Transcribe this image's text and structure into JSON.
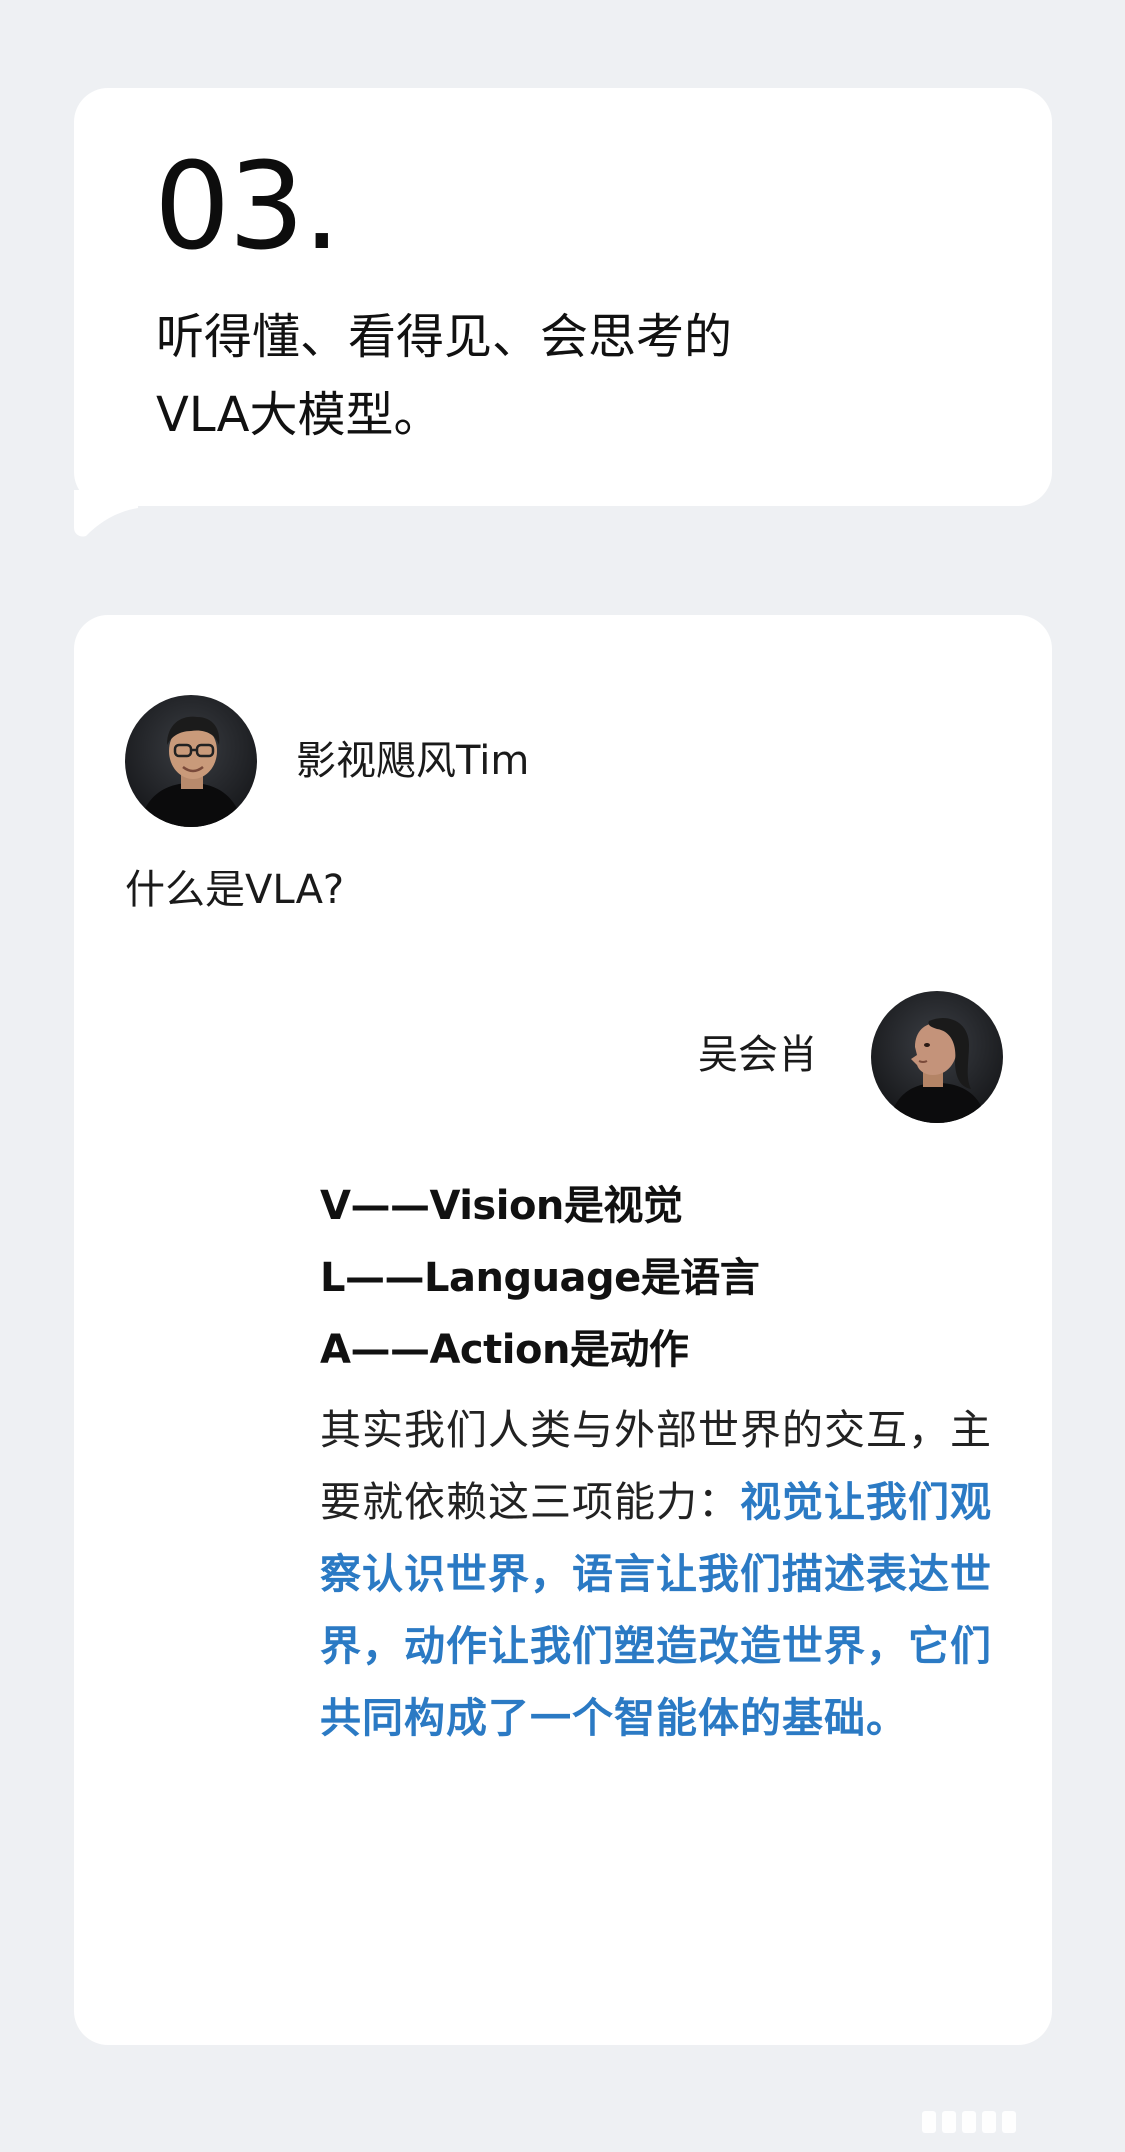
{
  "section": {
    "number": "03.",
    "title_line1": "听得懂、看得见、会思考的",
    "title_line2": "VLA大模型。"
  },
  "dialog": {
    "interviewer": {
      "name": "影视飓风Tim",
      "avatar_icon": "person-with-glasses-avatar",
      "question": "什么是VLA?"
    },
    "respondent": {
      "name": "吴会肖",
      "avatar_icon": "person-profile-avatar",
      "definitions": [
        "V——Vision是视觉",
        "L——Language是语言",
        "A——Action是动作"
      ],
      "answer_plain": "其实我们人类与外部世界的交互，主要就依赖这三项能力：",
      "answer_highlight": "视觉让我们观察认识世界，语言让我们描述表达世界，动作让我们塑造改造世界，它们共同构成了一个智能体的基础。",
      "highlight_color": "#2b7ac4"
    }
  },
  "colors": {
    "background": "#eef0f3",
    "card": "#ffffff",
    "text": "#111111"
  }
}
